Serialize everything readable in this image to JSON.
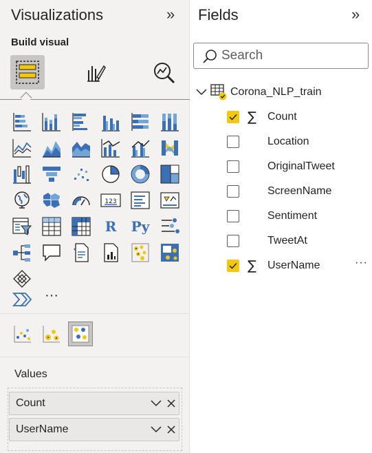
{
  "visualizations": {
    "title": "Visualizations",
    "collapse_glyph": "»",
    "build_label": "Build visual",
    "mode_tabs": [
      {
        "icon": "build-visual-icon",
        "active": true
      },
      {
        "icon": "format-visual-icon",
        "active": false
      },
      {
        "icon": "analytics-icon",
        "active": false
      }
    ],
    "icons": [
      "stacked-bar-chart-icon",
      "stacked-column-chart-icon",
      "clustered-bar-chart-icon",
      "clustered-column-chart-icon",
      "100-stacked-bar-chart-icon",
      "100-stacked-column-chart-icon",
      "line-chart-icon",
      "area-chart-icon",
      "stacked-area-chart-icon",
      "line-and-stacked-column-chart-icon",
      "line-and-clustered-column-chart-icon",
      "ribbon-chart-icon",
      "waterfall-chart-icon",
      "funnel-chart-icon",
      "scatter-chart-icon",
      "pie-chart-icon",
      "donut-chart-icon",
      "treemap-icon",
      "map-icon",
      "filled-map-icon",
      "gauge-icon",
      "card-icon",
      "multi-row-card-icon",
      "kpi-icon",
      "slicer-icon",
      "table-icon",
      "matrix-icon",
      "r-script-visual-icon",
      "python-visual-icon",
      "key-influencers-icon",
      "decomposition-tree-icon",
      "qa-icon",
      "smart-narrative-icon",
      "paginated-report-icon",
      "custom-visual-a-icon",
      "custom-visual-b-icon",
      "power-apps-icon",
      "power-automate-icon",
      "more-visuals-icon"
    ],
    "r_label": "R",
    "py_label": "Py",
    "more_label": "···",
    "custom_visuals": [
      {
        "icon": "custom-scatter-icon",
        "active": false
      },
      {
        "icon": "custom-bubble-icon",
        "active": false
      },
      {
        "icon": "custom-cluster-icon",
        "active": true
      }
    ],
    "values_label": "Values",
    "wells": [
      {
        "name": "Count"
      },
      {
        "name": "UserName"
      }
    ]
  },
  "fields": {
    "title": "Fields",
    "collapse_glyph": "»",
    "search_placeholder": "Search",
    "table_name": "Corona_NLP_train",
    "items": [
      {
        "name": "Count",
        "checked": true,
        "sigma": "∑"
      },
      {
        "name": "Location",
        "checked": false,
        "sigma": ""
      },
      {
        "name": "OriginalTweet",
        "checked": false,
        "sigma": ""
      },
      {
        "name": "ScreenName",
        "checked": false,
        "sigma": ""
      },
      {
        "name": "Sentiment",
        "checked": false,
        "sigma": ""
      },
      {
        "name": "TweetAt",
        "checked": false,
        "sigma": ""
      },
      {
        "name": "UserName",
        "checked": true,
        "sigma": "∑"
      }
    ],
    "more_label": "···"
  },
  "colors": {
    "accent_yellow": "#f2c811",
    "chart_blue": "#3b6fb6",
    "chart_light_blue": "#72a5d8",
    "panel_bg": "#f3f2f1"
  }
}
